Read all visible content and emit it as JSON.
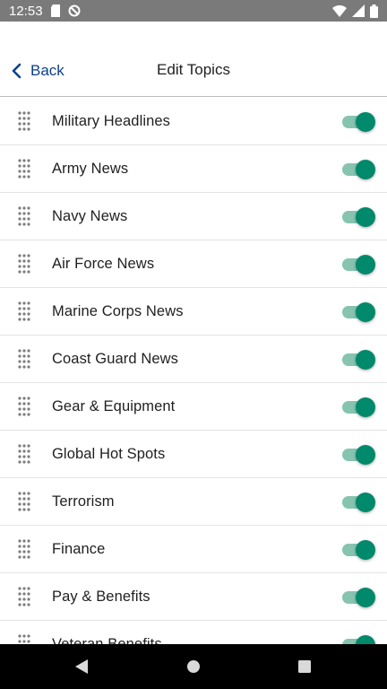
{
  "status_bar": {
    "time": "12:53",
    "left_icons": [
      "sd-card-icon",
      "no-disturb-icon"
    ],
    "right_icons": [
      "wifi-icon",
      "signal-icon",
      "battery-icon"
    ]
  },
  "header": {
    "back_label": "Back",
    "title": "Edit Topics"
  },
  "topics": [
    {
      "label": "Military Headlines",
      "enabled": true
    },
    {
      "label": "Army News",
      "enabled": true
    },
    {
      "label": "Navy News",
      "enabled": true
    },
    {
      "label": "Air Force News",
      "enabled": true
    },
    {
      "label": "Marine Corps News",
      "enabled": true
    },
    {
      "label": "Coast Guard News",
      "enabled": true
    },
    {
      "label": "Gear & Equipment",
      "enabled": true
    },
    {
      "label": "Global Hot Spots",
      "enabled": true
    },
    {
      "label": "Terrorism",
      "enabled": true
    },
    {
      "label": "Finance",
      "enabled": true
    },
    {
      "label": "Pay & Benefits",
      "enabled": true
    },
    {
      "label": "Veteran Benefits",
      "enabled": true
    }
  ],
  "colors": {
    "accent": "#00896b",
    "track_on": "#86c4b0",
    "back_link": "#0d3f8f",
    "status_bar": "#7a7a7a"
  }
}
